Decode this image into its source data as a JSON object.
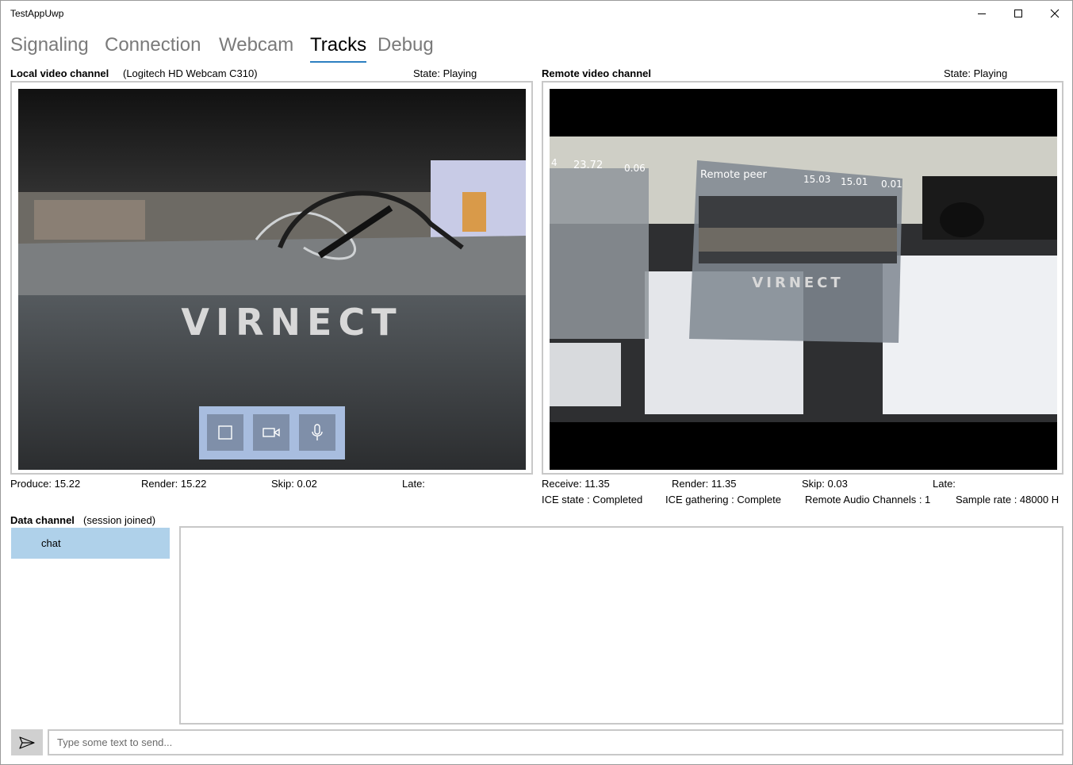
{
  "app": {
    "title": "TestAppUwp"
  },
  "tabs": [
    {
      "label": "Signaling"
    },
    {
      "label": "Connection"
    },
    {
      "label": "Webcam"
    },
    {
      "label": "Tracks"
    },
    {
      "label": "Debug"
    }
  ],
  "active_tab": "Tracks",
  "local": {
    "heading": "Local video channel",
    "device": "(Logitech HD Webcam C310)",
    "state": "State: Playing",
    "stats": {
      "produce": "Produce: 15.22",
      "render": "Render: 15.22",
      "skip": "Skip: 0.02",
      "late": "Late:"
    },
    "video_text": "VIRNECT"
  },
  "remote": {
    "heading": "Remote video channel",
    "state": "State: Playing",
    "stats": {
      "receive": "Receive: 11.35",
      "render": "Render: 11.35",
      "skip": "Skip: 0.03",
      "late": "Late:"
    },
    "info": {
      "ice_state": "ICE state :  Completed",
      "ice_gathering": "ICE gathering :  Complete",
      "audio_channels": "Remote Audio Channels :  1",
      "sample_rate": "Sample rate :  48000 H"
    },
    "video_overlay": {
      "panel_title": "Remote peer",
      "values": [
        "15.03",
        "15.01",
        "0.01"
      ],
      "side_values": [
        "23.72",
        "0.06"
      ],
      "side_cut": "4",
      "logo_text": "VIRNECT"
    }
  },
  "data_channel": {
    "heading": "Data channel",
    "status": "(session joined)",
    "channels": [
      {
        "label": "chat"
      }
    ]
  },
  "message": {
    "placeholder": "Type some text to send..."
  },
  "icons": {
    "minimize": "minimize-icon",
    "maximize": "maximize-icon",
    "close": "close-icon",
    "stop": "stop-icon",
    "camera": "video-camera-icon",
    "mic": "microphone-icon",
    "send": "send-icon"
  },
  "colors": {
    "accent": "#2d7fc1",
    "chat_selected": "#afd1ea",
    "media_bar": "#a8bddf",
    "media_button": "#7f8fa9"
  }
}
